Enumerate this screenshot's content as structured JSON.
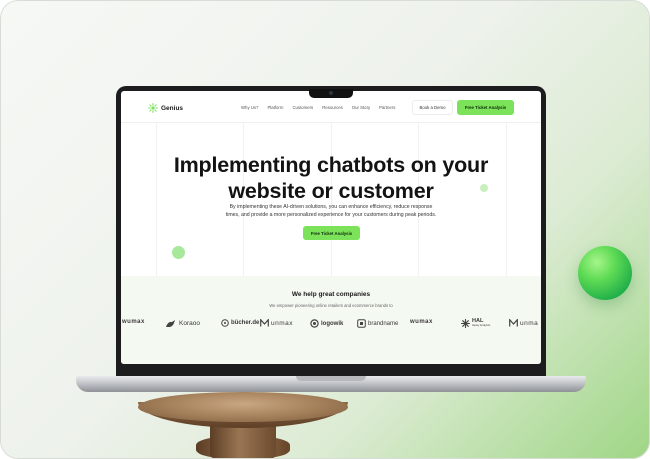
{
  "nav": {
    "brand": "Genius",
    "menu": [
      "Why Us?",
      "Platform",
      "Customers",
      "Resources",
      "Our Story",
      "Partners"
    ],
    "book_demo": "Book a Demo",
    "free_analysis": "Free Ticket Analysis"
  },
  "hero": {
    "title_line1": "Implementing chatbots on your",
    "title_line2": "website or customer",
    "subtitle_line1": "By implementing these AI-driven solutions, you can enhance efficiency, reduce response",
    "subtitle_line2": "times, and provide a more personalized experience for your customers during peak periods.",
    "cta": "Free Ticket Analysis"
  },
  "companies": {
    "title": "We help great companies",
    "subtitle": "We empower pioneering online retailers and ecommerce brands to",
    "logos": [
      "wumax",
      "Koraoo",
      "bücher.de",
      "unmax",
      "logowik",
      "brandname",
      "wumax",
      "HAL",
      "unma"
    ],
    "hal_caption": "Heavy Analytics"
  },
  "colors": {
    "accent": "#7be25a",
    "text": "#131313",
    "companies_bg": "#f4f9f2"
  }
}
